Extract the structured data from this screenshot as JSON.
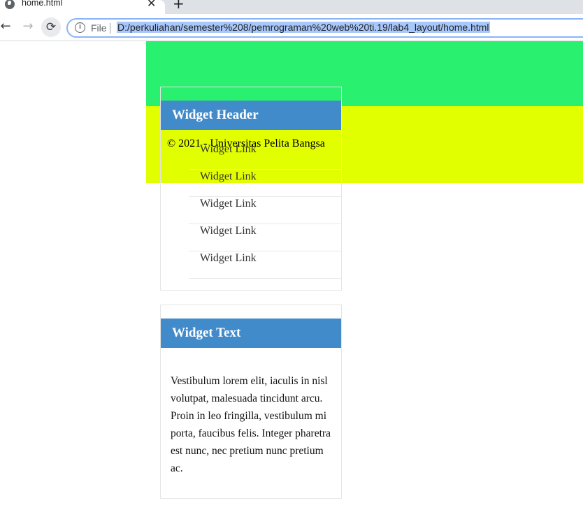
{
  "browser": {
    "tab": {
      "title": "home.html",
      "close_glyph": "✕",
      "favicon": "globe-icon"
    },
    "new_tab_glyph": "+",
    "nav": {
      "back_glyph": "←",
      "forward_glyph": "→",
      "reload_glyph": "⟳"
    },
    "address": {
      "info_glyph": "i",
      "scheme_label": "File",
      "url": "D:/perkuliahan/semester%208/pemrograman%20web%20ti.19/lab4_layout/home.html"
    }
  },
  "page": {
    "colors": {
      "green_band": "#2af070",
      "yellow_band": "#e2ff00",
      "widget_header": "#428bca"
    },
    "links_widget": {
      "header": "Widget Header",
      "links": [
        "Widget Link",
        "Widget Link",
        "Widget Link",
        "Widget Link",
        "Widget Link"
      ]
    },
    "text_widget": {
      "header": "Widget Text",
      "body": "Vestibulum lorem elit, iaculis in nisl volutpat, malesuada tincidunt arcu. Proin in leo fringilla, vestibulum mi porta, faucibus felis. Integer pharetra est nunc, nec pretium nunc pretium ac."
    },
    "footer": {
      "text": "© 2021 - Universitas Pelita Bangsa"
    }
  }
}
